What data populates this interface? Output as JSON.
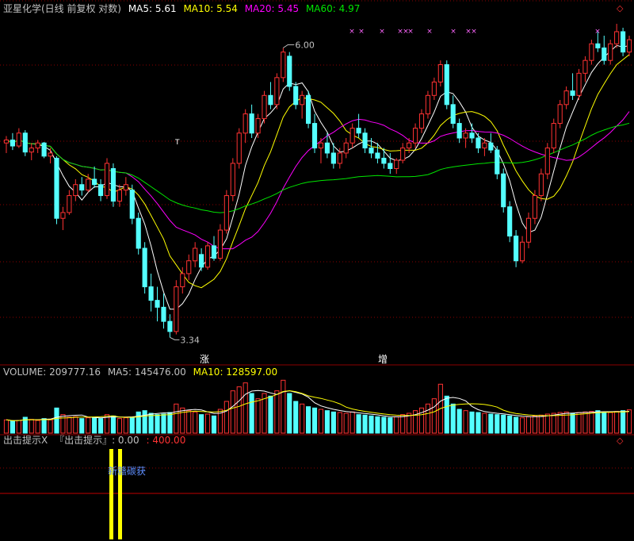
{
  "header": {
    "title": "亚星化学(日线 前复权 对数)",
    "ma5": "MA5: 5.61",
    "ma10": "MA10: 5.54",
    "ma20": "MA20: 5.45",
    "ma60": "MA60: 4.97"
  },
  "volume_header": {
    "label": "VOLUME: 209777.16",
    "ma5": "MA5: 145476.00",
    "ma10": "MA10: 128597.00"
  },
  "indicator_header": {
    "name": "出击提示",
    "close_glyph": "X",
    "value_label": "『出击提示』: 0.00",
    "level": ": 400.00"
  },
  "controls": {
    "diamond_top": "◇",
    "diamond_bottom": "◇"
  },
  "colors": {
    "up": "#ff3232",
    "down": "#54ffff",
    "ma5": "#ffffff",
    "ma10": "#ffff00",
    "ma20": "#ff00ff",
    "ma60": "#00e600",
    "title": "#c0c0c0",
    "grid": "#8b0000",
    "signal_bar": "#ffff00",
    "signal_text": "#5f8fff",
    "marker": "#ff66ff"
  },
  "chart_data": {
    "type": "candlestick",
    "price_high_label": "6.00",
    "price_low_label": "3.34",
    "annotation_up": "涨",
    "annotation_add": "增",
    "annotation_t": "T",
    "marker_symbol": "×",
    "signal_label": "新赣碳获",
    "price_range": [
      3.2,
      6.3
    ],
    "price_high_value": 6.0,
    "price_low_value": 3.34,
    "volume_range": [
      0,
      210000
    ],
    "indicator_level": 400,
    "candles": [
      [
        4.95,
        5.02,
        4.85,
        4.98
      ],
      [
        4.98,
        5.05,
        4.88,
        4.92
      ],
      [
        4.92,
        5.1,
        4.9,
        5.05
      ],
      [
        5.05,
        5.08,
        4.82,
        4.86
      ],
      [
        4.86,
        4.95,
        4.78,
        4.9
      ],
      [
        4.9,
        4.98,
        4.85,
        4.95
      ],
      [
        4.95,
        4.96,
        4.8,
        4.82
      ],
      [
        4.82,
        4.9,
        4.75,
        4.85
      ],
      [
        4.8,
        4.82,
        4.2,
        4.25
      ],
      [
        4.25,
        4.35,
        4.15,
        4.3
      ],
      [
        4.3,
        4.5,
        4.28,
        4.45
      ],
      [
        4.45,
        4.6,
        4.4,
        4.55
      ],
      [
        4.55,
        4.62,
        4.45,
        4.5
      ],
      [
        4.5,
        4.65,
        4.48,
        4.6
      ],
      [
        4.6,
        4.72,
        4.52,
        4.55
      ],
      [
        4.55,
        4.6,
        4.4,
        4.45
      ],
      [
        4.45,
        4.8,
        4.42,
        4.75
      ],
      [
        4.7,
        4.75,
        4.35,
        4.4
      ],
      [
        4.4,
        4.55,
        4.35,
        4.5
      ],
      [
        4.5,
        4.62,
        4.45,
        4.55
      ],
      [
        4.5,
        4.55,
        4.2,
        4.25
      ],
      [
        4.25,
        4.3,
        3.95,
        4.0
      ],
      [
        4.0,
        4.05,
        3.65,
        3.7
      ],
      [
        3.7,
        3.8,
        3.52,
        3.6
      ],
      [
        3.6,
        3.7,
        3.45,
        3.55
      ],
      [
        3.55,
        3.65,
        3.4,
        3.45
      ],
      [
        3.45,
        3.5,
        3.34,
        3.38
      ],
      [
        3.38,
        3.75,
        3.36,
        3.7
      ],
      [
        3.7,
        3.85,
        3.65,
        3.8
      ],
      [
        3.8,
        3.95,
        3.75,
        3.9
      ],
      [
        3.9,
        4.05,
        3.85,
        4.0
      ],
      [
        3.95,
        4.0,
        3.82,
        3.85
      ],
      [
        3.85,
        4.05,
        3.83,
        4.02
      ],
      [
        4.02,
        4.1,
        3.9,
        3.92
      ],
      [
        3.92,
        4.2,
        3.9,
        4.15
      ],
      [
        4.15,
        4.5,
        4.12,
        4.45
      ],
      [
        4.45,
        4.8,
        4.4,
        4.75
      ],
      [
        4.75,
        5.1,
        4.7,
        5.05
      ],
      [
        5.05,
        5.3,
        4.95,
        5.25
      ],
      [
        5.25,
        5.35,
        5.0,
        5.05
      ],
      [
        5.05,
        5.25,
        5.0,
        5.2
      ],
      [
        5.2,
        5.5,
        5.15,
        5.45
      ],
      [
        5.45,
        5.6,
        5.3,
        5.35
      ],
      [
        5.35,
        5.7,
        5.3,
        5.65
      ],
      [
        5.65,
        6.0,
        5.6,
        5.95
      ],
      [
        5.9,
        5.95,
        5.5,
        5.55
      ],
      [
        5.55,
        5.6,
        5.3,
        5.35
      ],
      [
        5.35,
        5.5,
        5.2,
        5.45
      ],
      [
        5.45,
        5.5,
        5.1,
        5.15
      ],
      [
        5.15,
        5.25,
        4.85,
        4.9
      ],
      [
        4.9,
        5.0,
        4.75,
        4.95
      ],
      [
        4.95,
        5.05,
        4.8,
        4.85
      ],
      [
        4.85,
        4.95,
        4.7,
        4.75
      ],
      [
        4.75,
        4.9,
        4.7,
        4.85
      ],
      [
        4.85,
        5.0,
        4.8,
        4.95
      ],
      [
        4.95,
        5.15,
        4.9,
        5.1
      ],
      [
        5.1,
        5.25,
        5.0,
        5.05
      ],
      [
        5.05,
        5.1,
        4.85,
        4.9
      ],
      [
        4.9,
        5.0,
        4.8,
        4.85
      ],
      [
        4.85,
        4.95,
        4.75,
        4.8
      ],
      [
        4.8,
        4.9,
        4.7,
        4.75
      ],
      [
        4.75,
        4.85,
        4.65,
        4.7
      ],
      [
        4.7,
        4.8,
        4.65,
        4.78
      ],
      [
        4.78,
        4.95,
        4.75,
        4.9
      ],
      [
        4.9,
        5.0,
        4.85,
        4.95
      ],
      [
        4.95,
        5.15,
        4.9,
        5.1
      ],
      [
        5.1,
        5.3,
        5.05,
        5.25
      ],
      [
        5.25,
        5.5,
        5.2,
        5.45
      ],
      [
        5.45,
        5.65,
        5.4,
        5.6
      ],
      [
        5.6,
        5.85,
        5.55,
        5.8
      ],
      [
        5.8,
        5.85,
        5.3,
        5.35
      ],
      [
        5.35,
        5.45,
        5.1,
        5.15
      ],
      [
        5.15,
        5.2,
        4.95,
        5.0
      ],
      [
        5.0,
        5.1,
        4.9,
        5.05
      ],
      [
        5.05,
        5.15,
        4.95,
        5.0
      ],
      [
        5.0,
        5.05,
        4.85,
        4.9
      ],
      [
        4.9,
        5.0,
        4.82,
        4.95
      ],
      [
        4.95,
        5.05,
        4.85,
        4.88
      ],
      [
        4.88,
        4.92,
        4.6,
        4.65
      ],
      [
        4.65,
        4.7,
        4.3,
        4.35
      ],
      [
        4.35,
        4.4,
        4.05,
        4.1
      ],
      [
        4.1,
        4.15,
        3.85,
        3.9
      ],
      [
        3.9,
        4.1,
        3.88,
        4.05
      ],
      [
        4.05,
        4.3,
        4.0,
        4.25
      ],
      [
        4.25,
        4.5,
        4.2,
        4.45
      ],
      [
        4.45,
        4.7,
        4.4,
        4.65
      ],
      [
        4.65,
        4.95,
        4.6,
        4.9
      ],
      [
        4.9,
        5.2,
        4.85,
        5.15
      ],
      [
        5.15,
        5.4,
        5.1,
        5.35
      ],
      [
        5.35,
        5.55,
        5.3,
        5.5
      ],
      [
        5.5,
        5.7,
        5.4,
        5.45
      ],
      [
        5.45,
        5.75,
        5.4,
        5.7
      ],
      [
        5.7,
        5.9,
        5.6,
        5.85
      ],
      [
        5.85,
        6.1,
        5.8,
        6.05
      ],
      [
        6.05,
        6.2,
        5.95,
        6.0
      ],
      [
        6.0,
        6.15,
        5.8,
        5.85
      ],
      [
        5.85,
        6.1,
        5.8,
        6.05
      ],
      [
        6.05,
        6.3,
        6.0,
        6.2
      ],
      [
        6.2,
        6.25,
        5.9,
        5.95
      ],
      [
        5.95,
        6.15,
        5.9,
        6.1
      ]
    ],
    "volumes": [
      50,
      45,
      48,
      60,
      52,
      48,
      55,
      50,
      95,
      70,
      60,
      62,
      55,
      58,
      60,
      55,
      70,
      65,
      55,
      58,
      60,
      80,
      85,
      75,
      70,
      72,
      78,
      110,
      95,
      85,
      80,
      70,
      72,
      65,
      90,
      120,
      160,
      175,
      190,
      150,
      130,
      150,
      140,
      160,
      200,
      150,
      120,
      110,
      100,
      95,
      90,
      85,
      80,
      78,
      75,
      80,
      70,
      68,
      65,
      62,
      60,
      58,
      62,
      70,
      75,
      85,
      95,
      110,
      130,
      185,
      140,
      110,
      90,
      85,
      80,
      78,
      75,
      72,
      70,
      68,
      65,
      60,
      58,
      62,
      65,
      68,
      72,
      75,
      78,
      80,
      75,
      78,
      80,
      82,
      85,
      80,
      78,
      82,
      85,
      88
    ]
  }
}
